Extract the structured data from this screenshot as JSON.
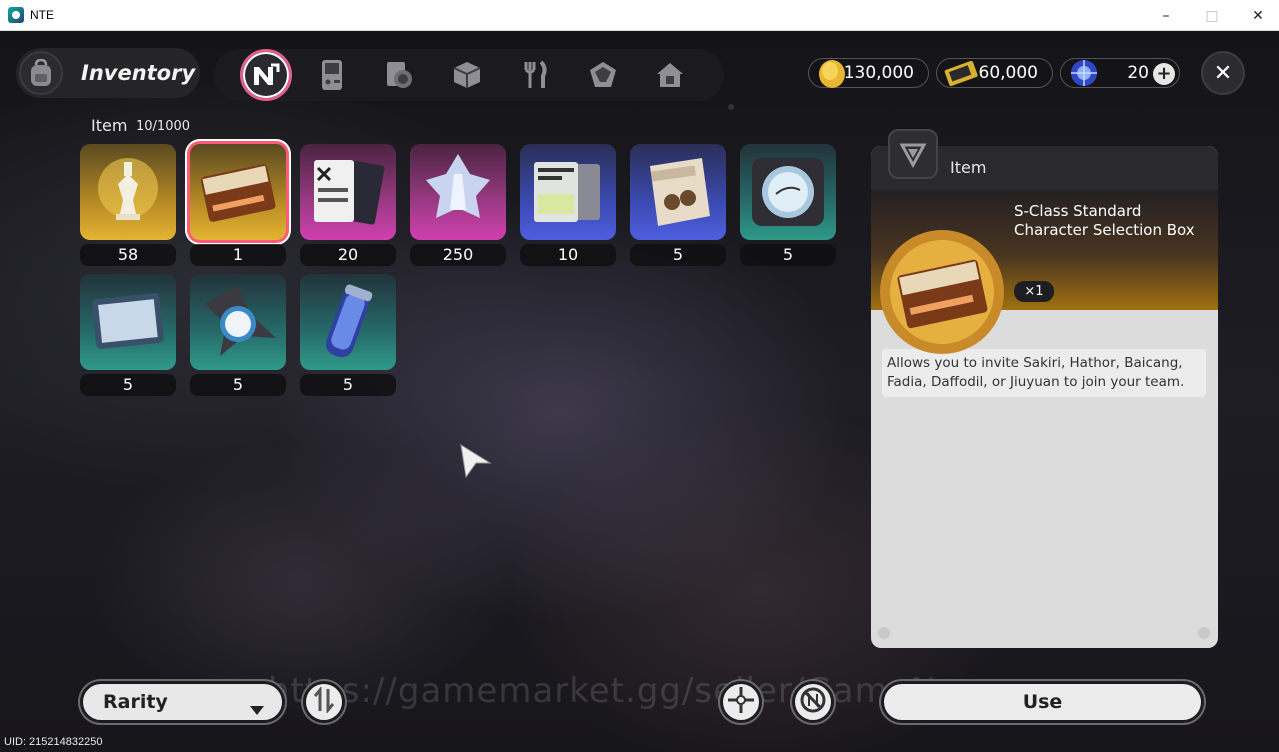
{
  "window": {
    "title": "NTE"
  },
  "header": {
    "title": "Inventory",
    "categories": [
      {
        "icon": "nte-logo-icon",
        "active": true
      },
      {
        "icon": "handheld-console-icon"
      },
      {
        "icon": "books-icon"
      },
      {
        "icon": "box-icon"
      },
      {
        "icon": "fork-knife-icon"
      },
      {
        "icon": "gem-cube-icon"
      },
      {
        "icon": "home-icon"
      }
    ]
  },
  "currency": {
    "coins": "130,000",
    "tickets": "60,000",
    "crystals": "20"
  },
  "grid": {
    "label": "Item",
    "count": "10/1000",
    "items": [
      {
        "qty": "58",
        "rarity": "gold",
        "icon": "chess-king-emblem-icon"
      },
      {
        "qty": "1",
        "rarity": "gold",
        "icon": "selection-box-icon",
        "selected": true
      },
      {
        "qty": "20",
        "rarity": "pink",
        "icon": "card-set-icon"
      },
      {
        "qty": "250",
        "rarity": "pink",
        "icon": "crystal-tower-icon"
      },
      {
        "qty": "10",
        "rarity": "blue",
        "icon": "tickets-icon"
      },
      {
        "qty": "5",
        "rarity": "blue",
        "icon": "snack-bag-icon"
      },
      {
        "qty": "5",
        "rarity": "green",
        "icon": "gauge-device-icon"
      },
      {
        "qty": "5",
        "rarity": "green",
        "icon": "tablet-icon"
      },
      {
        "qty": "5",
        "rarity": "green",
        "icon": "compass-spinner-icon"
      },
      {
        "qty": "5",
        "rarity": "green",
        "icon": "canister-icon"
      }
    ]
  },
  "detail": {
    "category": "Item",
    "name": "S-Class Standard Character Selection Box",
    "count": "×1",
    "description": "Allows you to invite Sakiri, Hathor, Baicang, Fadia, Daffodil, or Jiuyuan to join your team."
  },
  "bottom": {
    "sort_label": "Rarity",
    "use_label": "Use",
    "uid": "UID: 215214832250",
    "watermark": "https://gamemarket.gg/seller/GameNews"
  },
  "colors": {
    "selected_border": "#ff5a78",
    "gold": "#e5b431",
    "pink": "#d13fb0",
    "blue": "#4e5fe0",
    "green": "#2f9a88"
  }
}
